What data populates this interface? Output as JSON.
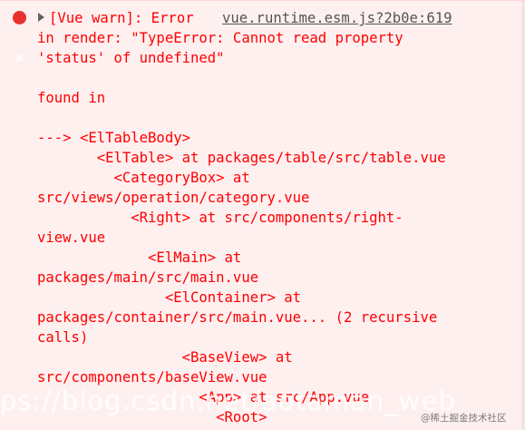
{
  "entry": {
    "icon": "error-circle-icon",
    "expand_icon": "triangle-right-icon",
    "header_text": "[Vue warn]: Error ",
    "source_link": "vue.runtime.esm.js?2b0e:619",
    "lines": [
      "in render: \"TypeError: Cannot read property",
      "'status' of undefined\"",
      "",
      "found in",
      "",
      "---> <ElTableBody>",
      "       <ElTable> at packages/table/src/table.vue",
      "         <CategoryBox> at",
      "src/views/operation/category.vue",
      "           <Right> at src/components/right-",
      "view.vue",
      "             <ElMain> at",
      "packages/main/src/main.vue",
      "               <ElContainer> at",
      "packages/container/src/main.vue... (2 recursive",
      "calls)",
      "                 <BaseView> at",
      "src/components/baseView.vue",
      "                   <App> at src/App.vue",
      "                     <Root>"
    ]
  },
  "colors": {
    "background": "#fff0f0",
    "error_text": "#ff0000",
    "link_text": "#545454",
    "icon_red": "#e8312f"
  },
  "watermark": {
    "url_text": "ps://blog.csdn.net/aotaman_web",
    "brand_text": "@稀土掘金技术社区"
  }
}
